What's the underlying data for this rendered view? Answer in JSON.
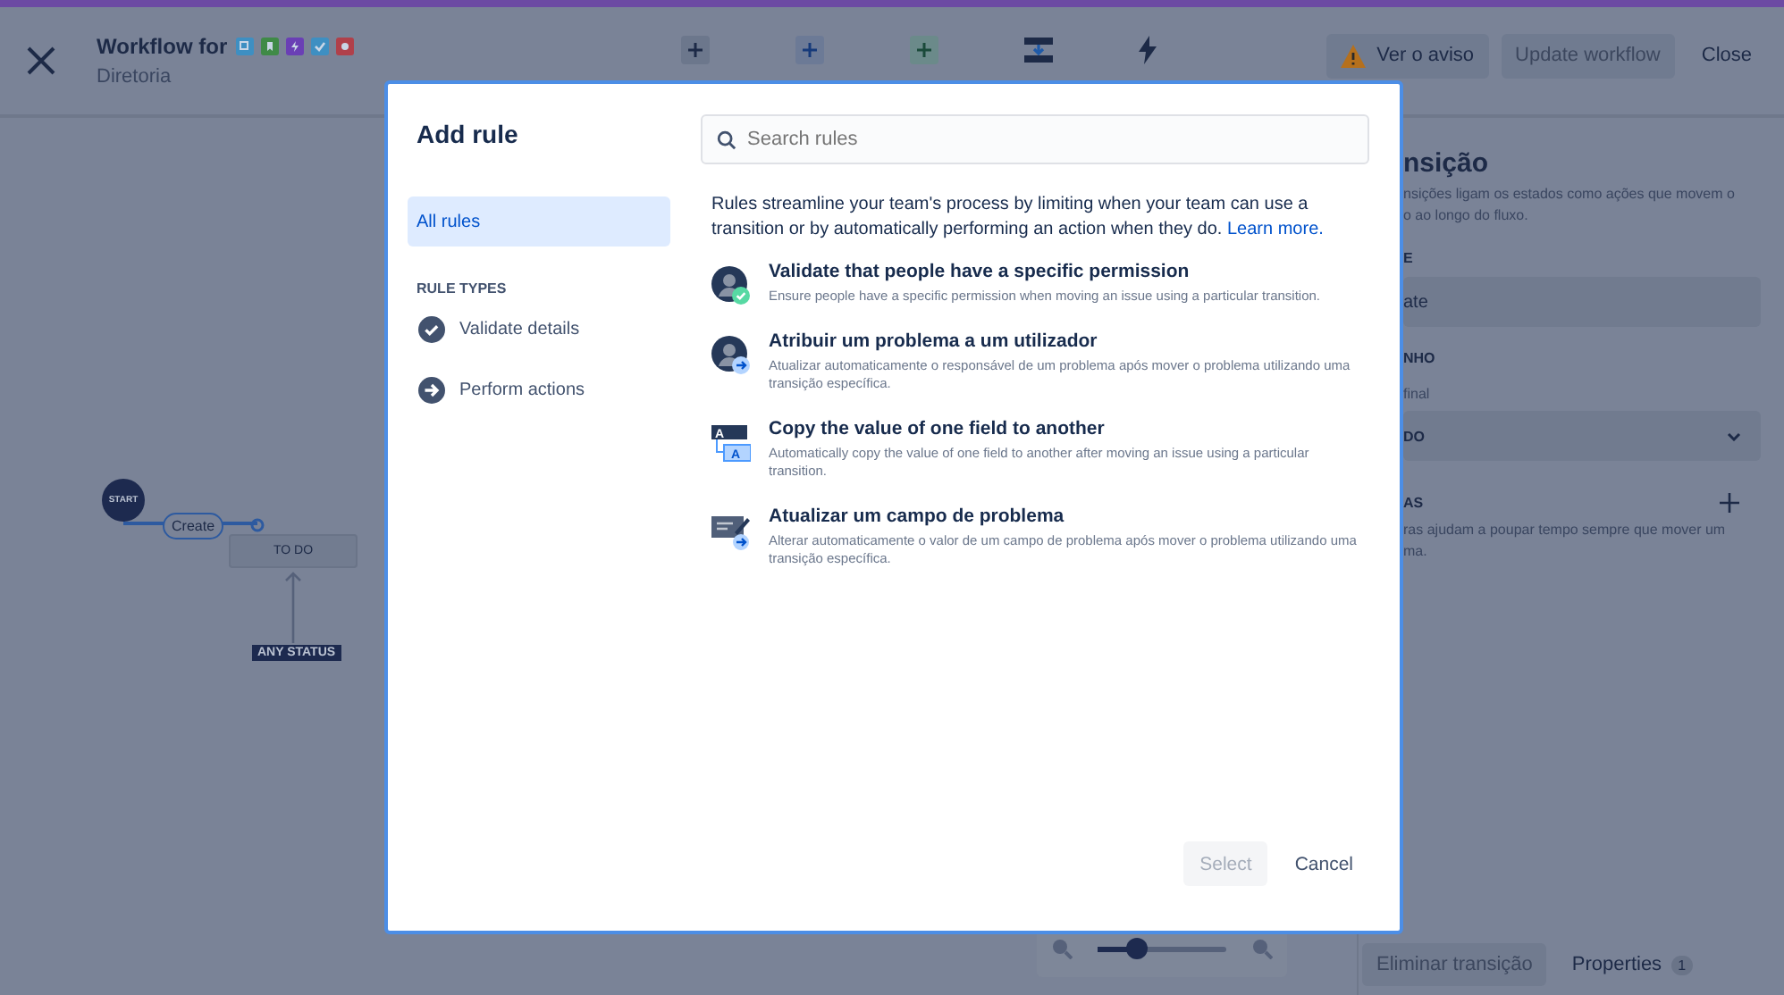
{
  "header": {
    "title": "Workflow for",
    "subtitle": "Diretoria",
    "issue_types": [
      {
        "kind": "subtask",
        "color": "#3e8fc2"
      },
      {
        "kind": "story",
        "color": "#3f8a47"
      },
      {
        "kind": "epic",
        "color": "#6a3fb5"
      },
      {
        "kind": "task",
        "color": "#3e8fc2"
      },
      {
        "kind": "bug",
        "color": "#b0404a"
      }
    ],
    "warning_button": {
      "label": "Ver o aviso"
    },
    "update_button": {
      "label": "Update workflow",
      "disabled": true
    },
    "close_button": {
      "label": "Close"
    }
  },
  "canvas": {
    "start": "START",
    "transition": "Create",
    "status": "TO DO",
    "any_status": "ANY STATUS",
    "zoom": {
      "level": 0.3
    }
  },
  "panel": {
    "title": "nsição",
    "description_lines": [
      "nsições ligam os estados como ações que movem o",
      "o ao longo do fluxo."
    ],
    "name_label": "E",
    "name_value": "ate",
    "dest_label": "NHO",
    "dest_hint": "final",
    "dest_value": "DO",
    "rules_label": "AS",
    "rules_description_lines": [
      "ras ajudam a poupar tempo sempre que mover um",
      "ma."
    ],
    "delete_button": {
      "label": "Eliminar transição",
      "disabled": true
    },
    "properties_tab": {
      "label": "Properties",
      "count": "1",
      "selected": true
    }
  },
  "modal": {
    "title": "Add rule",
    "search": {
      "placeholder": "Search rules"
    },
    "all_rules": {
      "label": "All rules",
      "selected": true
    },
    "rule_types_heading": "RULE TYPES",
    "rule_types": [
      {
        "kind": "validate",
        "label": "Validate details"
      },
      {
        "kind": "action",
        "label": "Perform actions"
      }
    ],
    "intro": {
      "text": "Rules streamline your team's process by limiting when your team can use a transition or by automatically performing an action when they do.",
      "link": "Learn more."
    },
    "rules": [
      {
        "kind": "permission",
        "title": "Validate that people have a specific permission",
        "description": "Ensure people have a specific permission when moving an issue using a particular transition."
      },
      {
        "kind": "assign",
        "title": "Atribuir um problema a um utilizador",
        "description": "Atualizar automaticamente o responsável de um problema após mover o problema utilizando uma transição específica."
      },
      {
        "kind": "copy",
        "icon_texts": [
          "A",
          "A"
        ],
        "title": "Copy the value of one field to another",
        "description": "Automatically copy the value of one field to another after moving an issue using a particular transition."
      },
      {
        "kind": "update",
        "title": "Atualizar um campo de problema",
        "description": "Alterar automaticamente o valor de um campo de problema após mover o problema utilizando uma transição específica."
      }
    ],
    "select_button": {
      "label": "Select",
      "disabled": true
    },
    "cancel_button": {
      "label": "Cancel"
    }
  }
}
